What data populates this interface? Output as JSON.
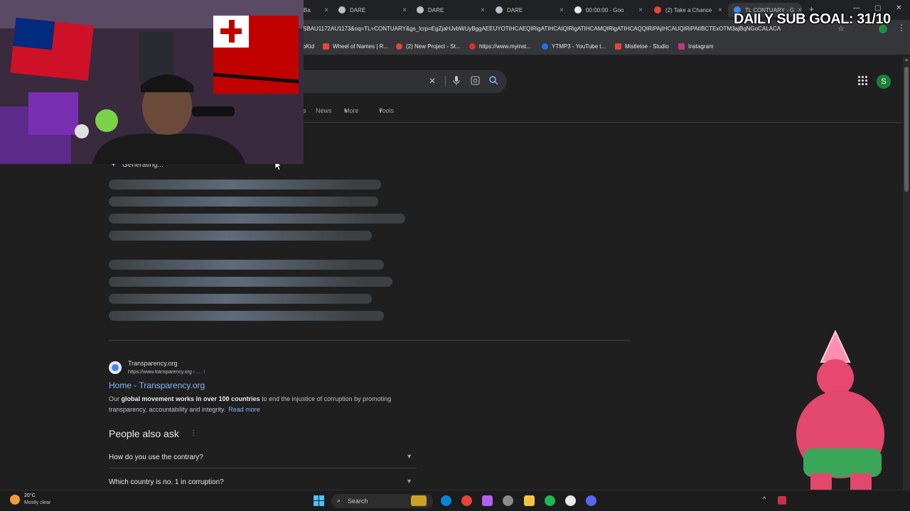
{
  "browser": {
    "tabs": [
      {
        "label": "- Ba",
        "fav_color": "#8ab4f8"
      },
      {
        "label": "DARE",
        "fav_color": "#bdc1c6"
      },
      {
        "label": "DARE",
        "fav_color": "#bdc1c6"
      },
      {
        "label": "DARE",
        "fav_color": "#bdc1c6"
      },
      {
        "label": "00:00:00 - Goo",
        "fav_color": "#e8eaed"
      },
      {
        "label": "(2) Take a Chance",
        "fav_color": "#ea4335"
      },
      {
        "label": "TL CONTUARY - G",
        "fav_color": "#4285f4"
      }
    ],
    "new_tab_label": "+",
    "url": "SBAU1172AU1173&oq=TL+CONTUARY&gs_lcrp=EgZjaHJvbWUyBggAEEUYOTIHCAEQIRigATIHCAIQIRigATIHCAMQIRigATIHCAQQIRiPAjIHCAUQIRiPAtIBCTExOTM3ajBqNGoCALACA",
    "bookmarks": [
      {
        "label": "oKid",
        "color": "#fbbc04"
      },
      {
        "label": "Wheel of Names | R...",
        "color": "#ea4335"
      },
      {
        "label": "(2) New Project - St...",
        "color": "#ea4335"
      },
      {
        "label": "https://www.myinst...",
        "color": "#d93025"
      },
      {
        "label": "YTMP3 - YouTube t...",
        "color": "#1a73e8"
      },
      {
        "label": "Mistletoe - Studio",
        "color": "#ea4335"
      },
      {
        "label": "Instagram",
        "color": "#c13584"
      }
    ]
  },
  "google": {
    "avatar_letter": "S",
    "nav_tabs": [
      "s",
      "News",
      "More",
      "Tools"
    ],
    "ai_status": "Generating...",
    "result": {
      "site_name": "Transparency.org",
      "url": "https://www.transparency.org › ...",
      "title": "Home - Transparency.org",
      "snippet_prefix": "Our ",
      "snippet_bold": "global movement works in over 100 countries",
      "snippet_rest": " to end the injustice of corruption by promoting transparency, accountability and integrity.",
      "read_more": "Read more"
    },
    "paa_title": "People also ask",
    "paa_questions": [
      "How do you use the contrary?",
      "Which country is no. 1 in corruption?"
    ]
  },
  "stream": {
    "goal_text": "DAILY SUB GOAL: 31/10"
  },
  "taskbar": {
    "weather_temp": "20°C",
    "weather_desc": "Mostly clear",
    "search_placeholder": "Search"
  },
  "colors": {
    "background": "#1f1f1f",
    "link": "#8ab4f8",
    "accent_green": "#188038"
  }
}
